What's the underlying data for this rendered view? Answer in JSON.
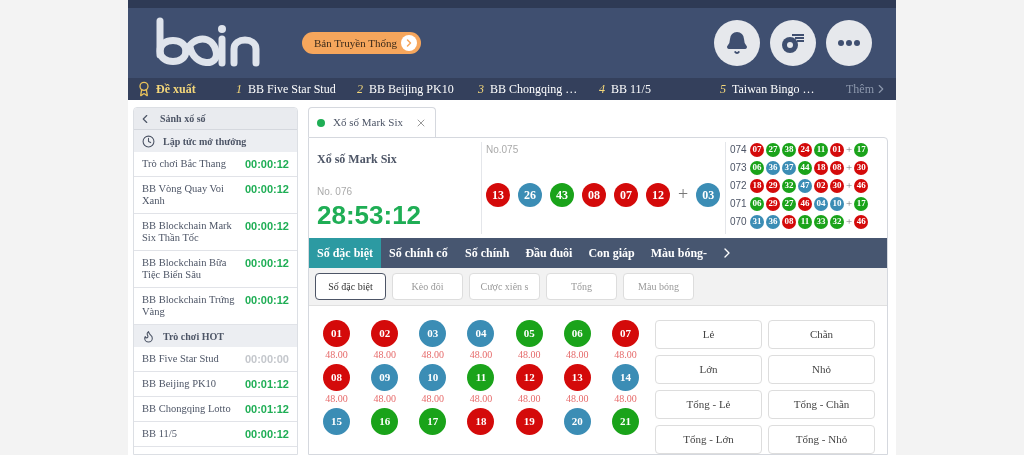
{
  "header": {
    "promo_button": "Bản Truyền Thống"
  },
  "recommend_bar": {
    "label": "Đề xuất",
    "items": [
      {
        "index": "1",
        "name": "BB Five Star Stud"
      },
      {
        "index": "2",
        "name": "BB Beijing PK10"
      },
      {
        "index": "3",
        "name": "BB Chongqing …"
      },
      {
        "index": "4",
        "name": "BB 11/5"
      },
      {
        "index": "5",
        "name": "Taiwan Bingo …"
      }
    ],
    "more": "Thêm"
  },
  "sidebar": {
    "back_label": "Sảnh xổ số",
    "sections": [
      {
        "kind": "clock",
        "title": "Lập tức mở thưởng",
        "items": [
          {
            "name": "Trò chơi Bắc Thang",
            "time": "00:00:12",
            "active": true
          },
          {
            "name": "BB Vòng Quay Voi Xanh",
            "time": "00:00:12",
            "active": true
          },
          {
            "name": "BB Blockchain Mark Six Thần Tốc",
            "time": "00:00:12",
            "active": true
          },
          {
            "name": "BB Blockchain Bữa Tiệc Biển Sâu",
            "time": "00:00:12",
            "active": true
          },
          {
            "name": "BB Blockchain Trứng Vàng",
            "time": "00:00:12",
            "active": true
          }
        ]
      },
      {
        "kind": "fire",
        "title": "Trò chơi HOT",
        "items": [
          {
            "name": "BB Five Star Stud",
            "time": "00:00:00",
            "active": false
          },
          {
            "name": "BB Beijing PK10",
            "time": "00:01:12",
            "active": true
          },
          {
            "name": "BB Chongqing Lotto",
            "time": "00:01:12",
            "active": true
          },
          {
            "name": "BB 11/5",
            "time": "00:00:12",
            "active": true
          }
        ]
      }
    ]
  },
  "game_tab": {
    "title": "Xổ số Mark Six"
  },
  "game": {
    "title": "Xổ số Mark Six",
    "next_no": "No. 076",
    "countdown": "28:53:12",
    "last_no": "No.075",
    "plus": "+",
    "last_draw": [
      {
        "n": "13",
        "color": "#d40a0a"
      },
      {
        "n": "26",
        "color": "#3b8db5"
      },
      {
        "n": "43",
        "color": "#1aa31a"
      },
      {
        "n": "08",
        "color": "#d40a0a"
      },
      {
        "n": "07",
        "color": "#d40a0a"
      },
      {
        "n": "12",
        "color": "#d40a0a"
      }
    ],
    "last_special": {
      "n": "03",
      "color": "#3b8db5"
    },
    "history": [
      {
        "no": "074",
        "balls": [
          {
            "n": "07",
            "color": "#d40a0a"
          },
          {
            "n": "27",
            "color": "#1aa31a"
          },
          {
            "n": "38",
            "color": "#1aa31a"
          },
          {
            "n": "24",
            "color": "#d40a0a"
          },
          {
            "n": "11",
            "color": "#1aa31a"
          },
          {
            "n": "01",
            "color": "#d40a0a"
          }
        ],
        "special": {
          "n": "17",
          "color": "#1aa31a"
        }
      },
      {
        "no": "073",
        "balls": [
          {
            "n": "06",
            "color": "#1aa31a"
          },
          {
            "n": "36",
            "color": "#3b8db5"
          },
          {
            "n": "37",
            "color": "#3b8db5"
          },
          {
            "n": "44",
            "color": "#1aa31a"
          },
          {
            "n": "18",
            "color": "#d40a0a"
          },
          {
            "n": "08",
            "color": "#d40a0a"
          }
        ],
        "special": {
          "n": "30",
          "color": "#d40a0a"
        }
      },
      {
        "no": "072",
        "balls": [
          {
            "n": "18",
            "color": "#d40a0a"
          },
          {
            "n": "29",
            "color": "#d40a0a"
          },
          {
            "n": "32",
            "color": "#1aa31a"
          },
          {
            "n": "47",
            "color": "#3b8db5"
          },
          {
            "n": "02",
            "color": "#d40a0a"
          },
          {
            "n": "30",
            "color": "#d40a0a"
          }
        ],
        "special": {
          "n": "46",
          "color": "#d40a0a"
        }
      },
      {
        "no": "071",
        "balls": [
          {
            "n": "06",
            "color": "#1aa31a"
          },
          {
            "n": "29",
            "color": "#d40a0a"
          },
          {
            "n": "27",
            "color": "#1aa31a"
          },
          {
            "n": "46",
            "color": "#d40a0a"
          },
          {
            "n": "04",
            "color": "#3b8db5"
          },
          {
            "n": "10",
            "color": "#3b8db5"
          }
        ],
        "special": {
          "n": "17",
          "color": "#1aa31a"
        }
      },
      {
        "no": "070",
        "balls": [
          {
            "n": "31",
            "color": "#3b8db5"
          },
          {
            "n": "36",
            "color": "#3b8db5"
          },
          {
            "n": "08",
            "color": "#d40a0a"
          },
          {
            "n": "11",
            "color": "#1aa31a"
          },
          {
            "n": "33",
            "color": "#1aa31a"
          },
          {
            "n": "32",
            "color": "#1aa31a"
          }
        ],
        "special": {
          "n": "46",
          "color": "#d40a0a"
        }
      }
    ]
  },
  "bet_tabs": [
    {
      "label": "Số đặc biệt",
      "selected": true
    },
    {
      "label": "Số chính cố",
      "selected": false
    },
    {
      "label": "Số chính",
      "selected": false
    },
    {
      "label": "Đầu đuôi",
      "selected": false
    },
    {
      "label": "Con giáp",
      "selected": false
    },
    {
      "label": "Màu bóng-",
      "selected": false
    }
  ],
  "sub_tabs": [
    {
      "label": "Số đặc biệt",
      "selected": true
    },
    {
      "label": "Kèo đôi",
      "selected": false
    },
    {
      "label": "Cược xiên s",
      "selected": false
    },
    {
      "label": "Tổng",
      "selected": false
    },
    {
      "label": "Màu bóng",
      "selected": false
    }
  ],
  "numbers": [
    {
      "n": "01",
      "color": "#d40a0a",
      "odds": "48.00"
    },
    {
      "n": "02",
      "color": "#d40a0a",
      "odds": "48.00"
    },
    {
      "n": "03",
      "color": "#3b8db5",
      "odds": "48.00"
    },
    {
      "n": "04",
      "color": "#3b8db5",
      "odds": "48.00"
    },
    {
      "n": "05",
      "color": "#1aa31a",
      "odds": "48.00"
    },
    {
      "n": "06",
      "color": "#1aa31a",
      "odds": "48.00"
    },
    {
      "n": "07",
      "color": "#d40a0a",
      "odds": "48.00"
    },
    {
      "n": "08",
      "color": "#d40a0a",
      "odds": "48.00"
    },
    {
      "n": "09",
      "color": "#3b8db5",
      "odds": "48.00"
    },
    {
      "n": "10",
      "color": "#3b8db5",
      "odds": "48.00"
    },
    {
      "n": "11",
      "color": "#1aa31a",
      "odds": "48.00"
    },
    {
      "n": "12",
      "color": "#d40a0a",
      "odds": "48.00"
    },
    {
      "n": "13",
      "color": "#d40a0a",
      "odds": "48.00"
    },
    {
      "n": "14",
      "color": "#3b8db5",
      "odds": "48.00"
    },
    {
      "n": "15",
      "color": "#3b8db5"
    },
    {
      "n": "16",
      "color": "#1aa31a"
    },
    {
      "n": "17",
      "color": "#1aa31a"
    },
    {
      "n": "18",
      "color": "#d40a0a"
    },
    {
      "n": "19",
      "color": "#d40a0a"
    },
    {
      "n": "20",
      "color": "#3b8db5"
    },
    {
      "n": "21",
      "color": "#1aa31a"
    }
  ],
  "bet_options": [
    "Lẻ",
    "Chẵn",
    "Lớn",
    "Nhỏ",
    "Tổng - Lẻ",
    "Tổng - Chẵn",
    "Tổng - Lớn",
    "Tổng - Nhỏ"
  ]
}
